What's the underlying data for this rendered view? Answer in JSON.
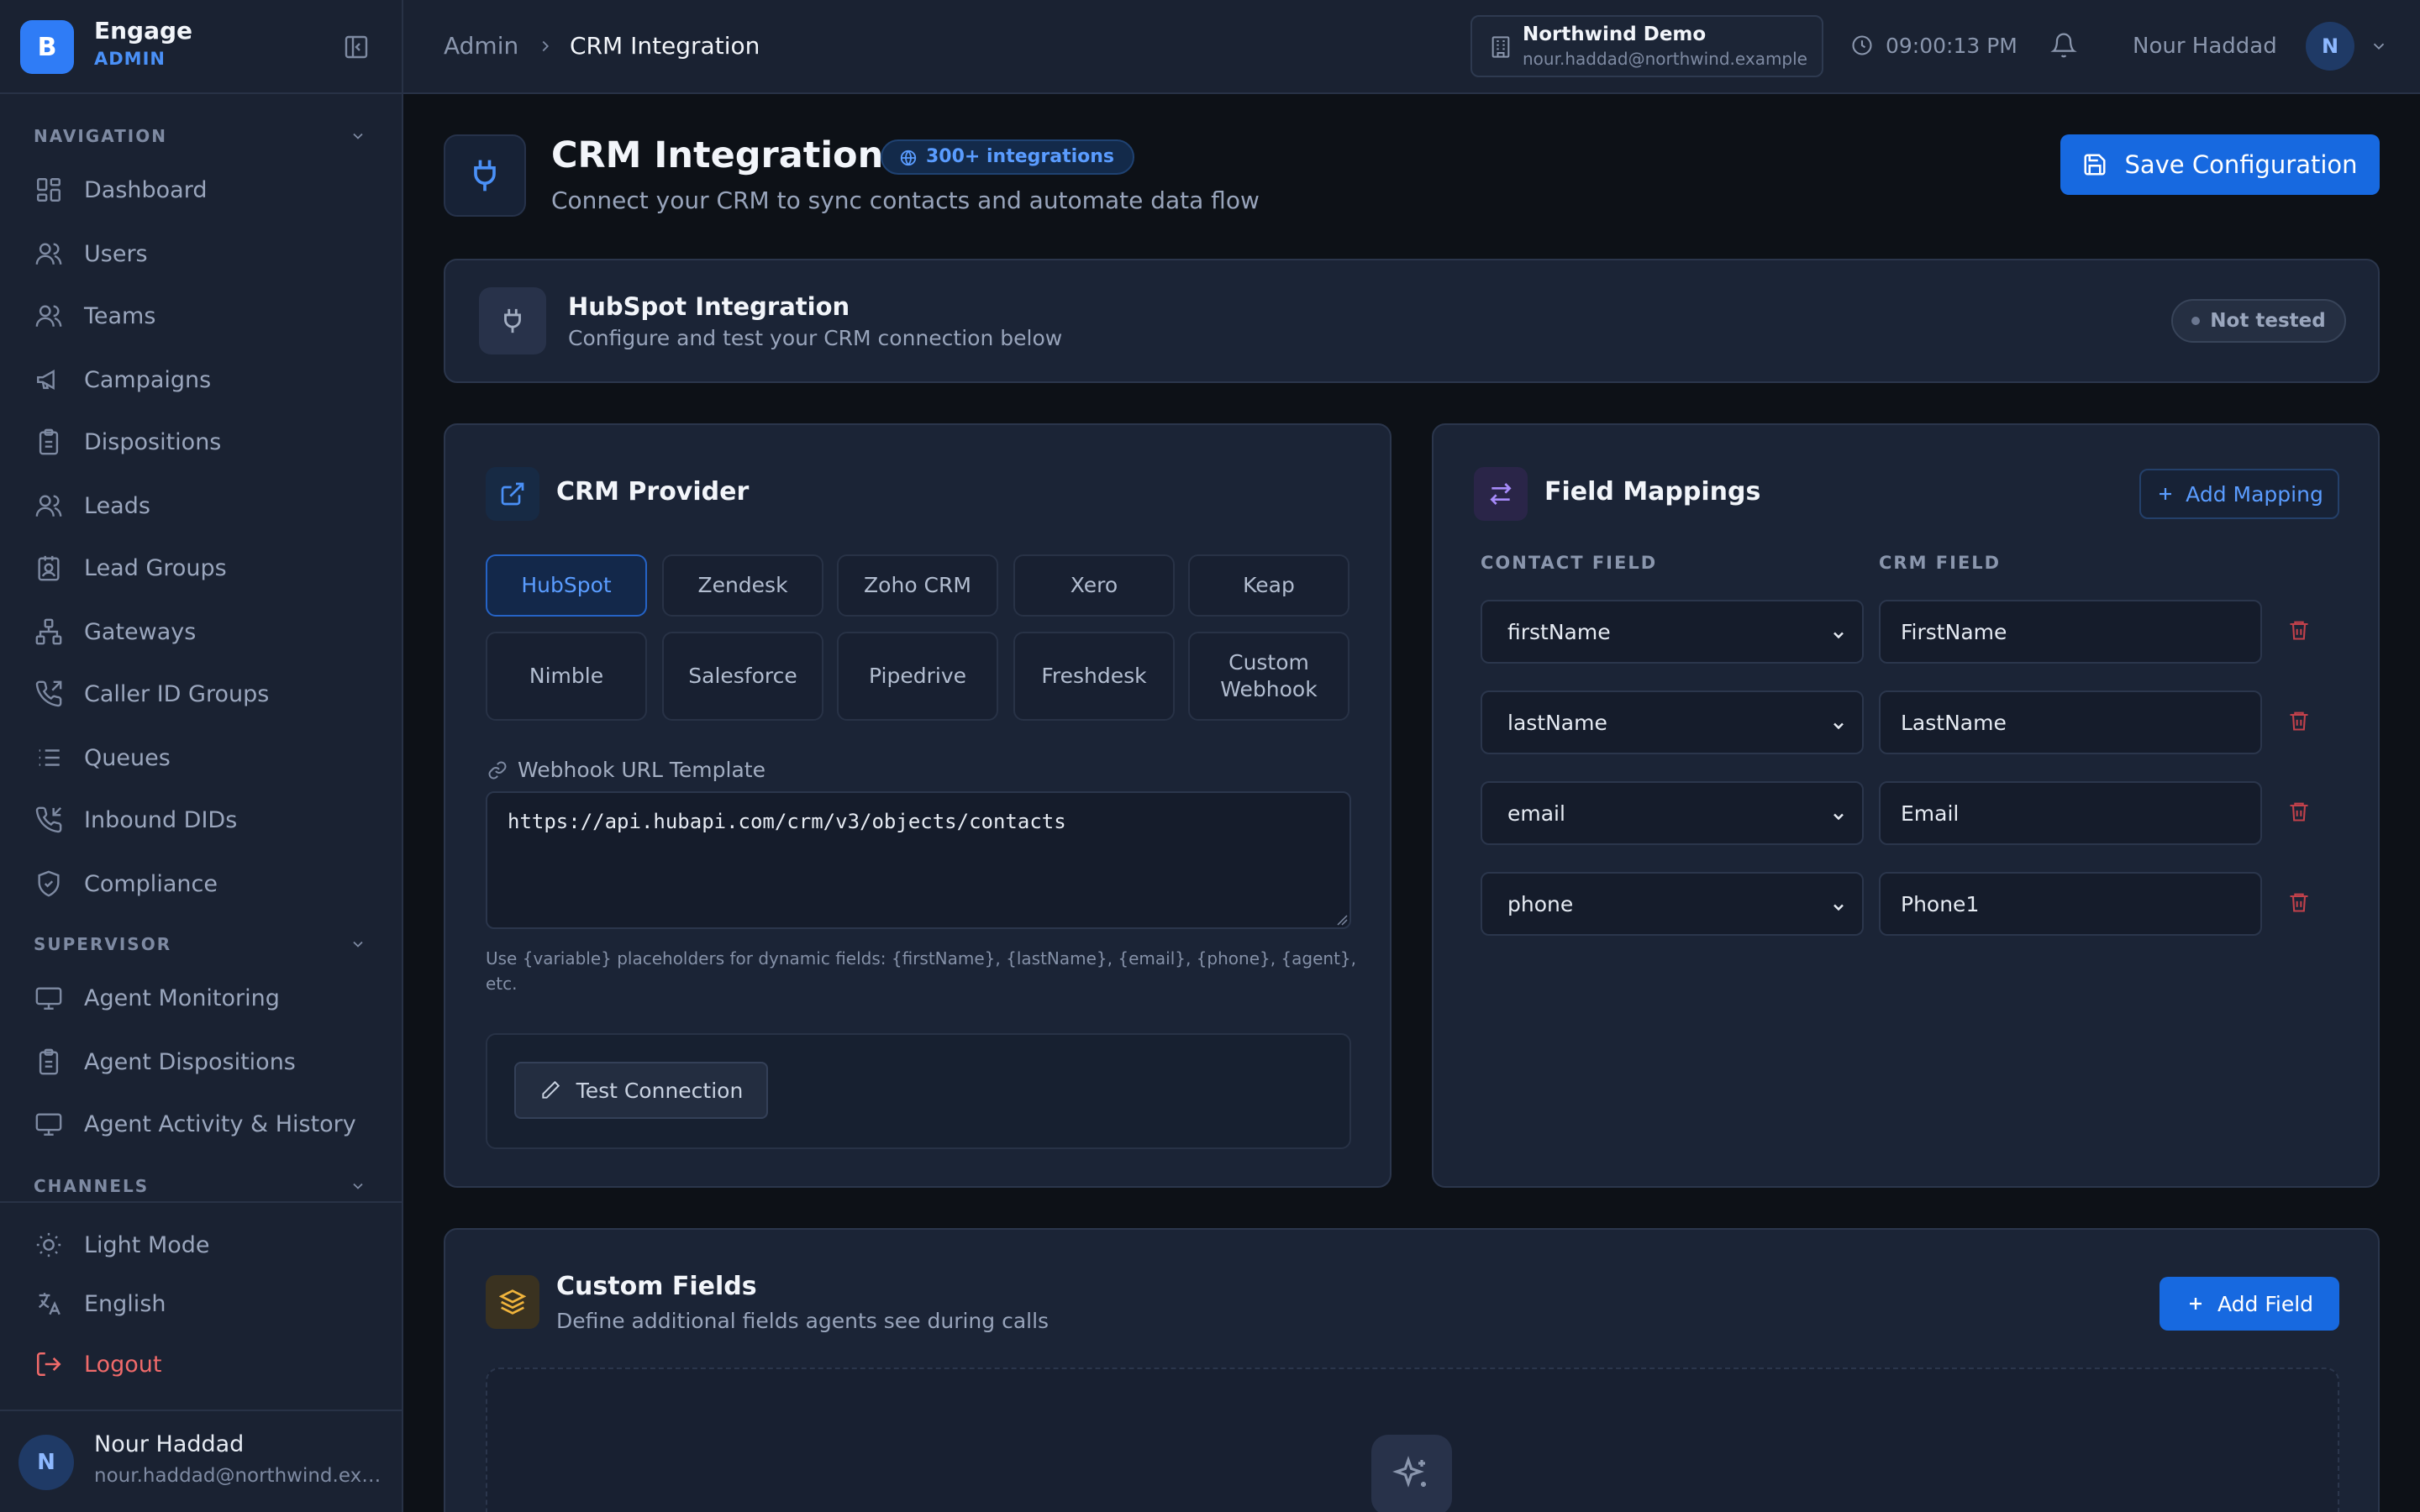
{
  "brand": {
    "logo_letter": "B",
    "name": "Engage",
    "role": "ADMIN"
  },
  "sidebar": {
    "sections": [
      {
        "title": "NAVIGATION",
        "items": [
          "Dashboard",
          "Users",
          "Teams",
          "Campaigns",
          "Dispositions",
          "Leads",
          "Lead Groups",
          "Gateways",
          "Caller ID Groups",
          "Queues",
          "Inbound DIDs",
          "Compliance"
        ]
      },
      {
        "title": "SUPERVISOR",
        "items": [
          "Agent Monitoring",
          "Agent Dispositions",
          "Agent Activity & History"
        ]
      },
      {
        "title": "CHANNELS",
        "items": []
      }
    ],
    "bottom": {
      "theme": "Light Mode",
      "language": "English",
      "logout": "Logout"
    },
    "user": {
      "initial": "N",
      "name": "Nour Haddad",
      "email": "nour.haddad@northwind.example"
    }
  },
  "header": {
    "breadcrumb": {
      "parent": "Admin",
      "current": "CRM Integration"
    },
    "org": {
      "name": "Northwind Demo",
      "email": "nour.haddad@northwind.example"
    },
    "clock": "09:00:13 PM",
    "user": {
      "name": "Nour Haddad",
      "initial": "N"
    }
  },
  "page": {
    "title": "CRM Integration",
    "badge": "300+ integrations",
    "subtitle": "Connect your CRM to sync contacts and automate data flow",
    "save_label": "Save Configuration"
  },
  "banner": {
    "title": "HubSpot Integration",
    "subtitle": "Configure and test your CRM connection below",
    "status": "Not tested"
  },
  "provider": {
    "title": "CRM Provider",
    "options": [
      "HubSpot",
      "Zendesk",
      "Zoho CRM",
      "Xero",
      "Keap",
      "Nimble",
      "Salesforce",
      "Pipedrive",
      "Freshdesk",
      "Custom Webhook"
    ],
    "selected": "HubSpot",
    "webhook_label": "Webhook URL Template",
    "webhook_value": "https://api.hubapi.com/crm/v3/objects/contacts",
    "hint": "Use {variable} placeholders for dynamic fields: {firstName}, {lastName}, {email}, {phone}, {agent}, etc.",
    "test_label": "Test Connection"
  },
  "mappings": {
    "title": "Field Mappings",
    "add_label": "Add Mapping",
    "contact_header": "CONTACT FIELD",
    "crm_header": "CRM FIELD",
    "rows": [
      {
        "contact": "firstName",
        "crm": "FirstName"
      },
      {
        "contact": "lastName",
        "crm": "LastName"
      },
      {
        "contact": "email",
        "crm": "Email"
      },
      {
        "contact": "phone",
        "crm": "Phone1"
      }
    ]
  },
  "custom_fields": {
    "title": "Custom Fields",
    "subtitle": "Define additional fields agents see during calls",
    "add_label": "Add Field"
  },
  "colors": {
    "accent": "#1769e0",
    "accent_text": "#5a9cff",
    "danger": "#f06a6a",
    "bg": "#0d1117",
    "panel": "#1b2436"
  }
}
